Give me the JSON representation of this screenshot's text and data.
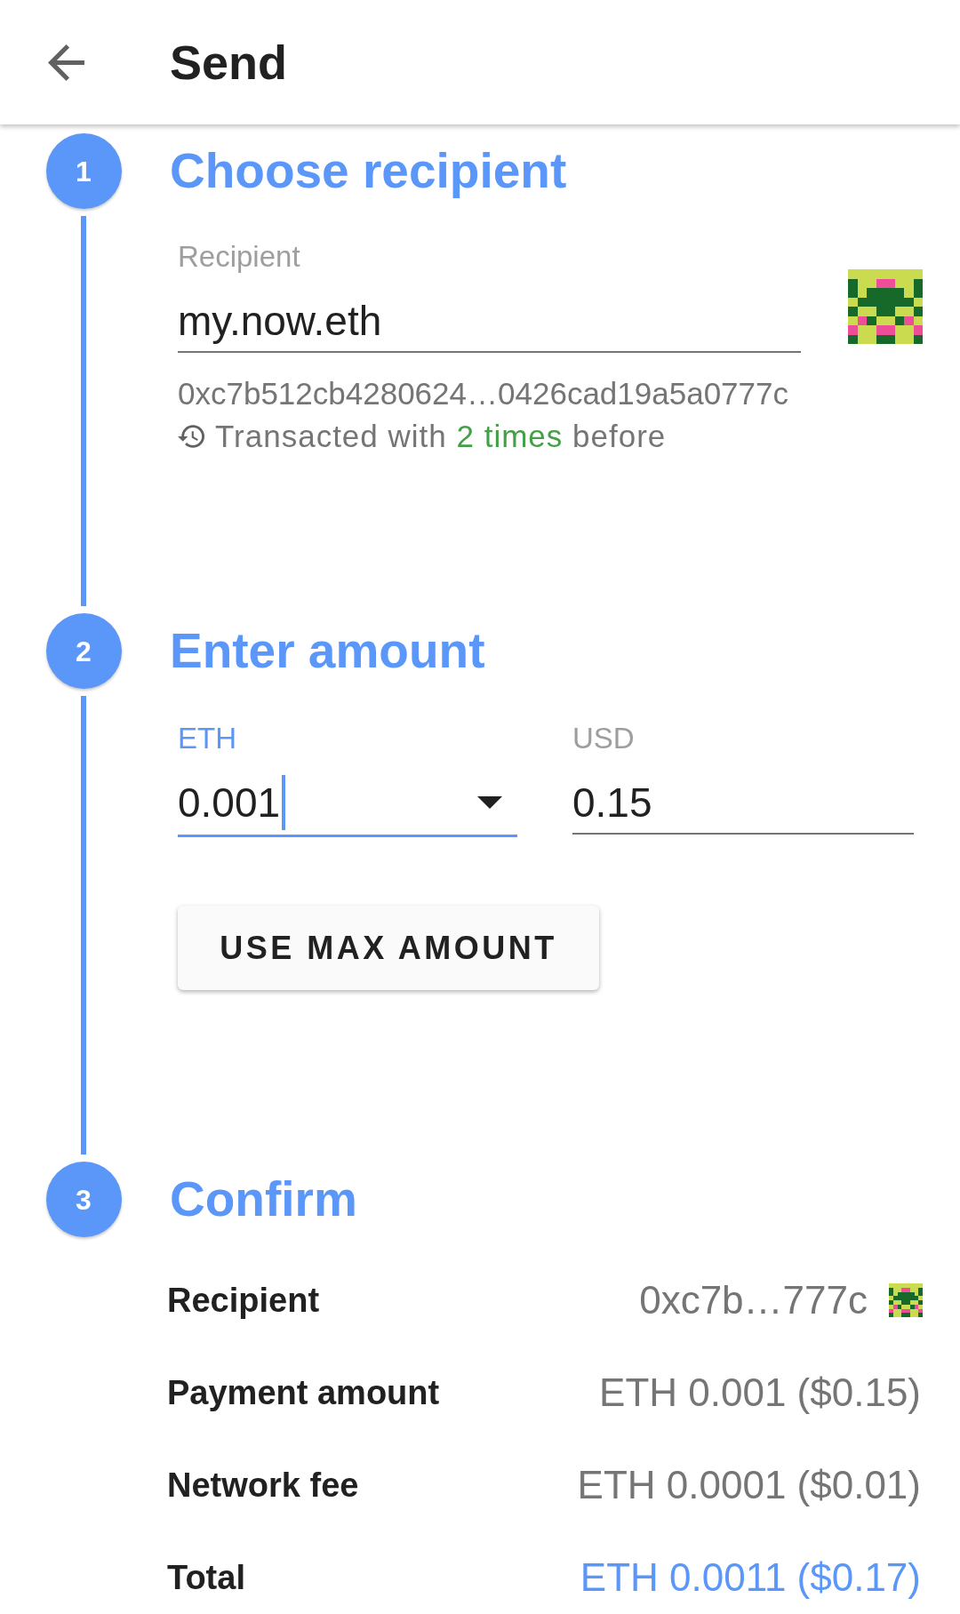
{
  "app_bar": {
    "title": "Send"
  },
  "steps": [
    {
      "number": "1",
      "title": "Choose recipient",
      "kind": "recipient",
      "field": {
        "label": "Recipient",
        "value": "my.now.eth",
        "focused": false,
        "dropdown": false
      },
      "address": "0xc7b512cb4280624…0426cad19a5a0777c",
      "history": {
        "text_before": "Transacted with",
        "highlight": "2 times",
        "text_after": "before"
      }
    },
    {
      "number": "2",
      "title": "Enter amount",
      "kind": "amount",
      "fields": [
        {
          "label": "ETH",
          "value": "0.001",
          "focused": true,
          "dropdown": true
        },
        {
          "label": "USD",
          "value": "0.15",
          "focused": false,
          "dropdown": false
        }
      ],
      "button": "USE MAX AMOUNT"
    },
    {
      "number": "3",
      "title": "Confirm",
      "kind": "summary",
      "rows": [
        {
          "label": "Recipient",
          "value": "0xc7b…777c",
          "kind": "address",
          "highlighted": false
        },
        {
          "label": "Payment amount",
          "value": "ETH 0.001 ($0.15)",
          "kind": "amount",
          "highlighted": false
        },
        {
          "label": "Network fee",
          "value": "ETH 0.0001 ($0.01)",
          "kind": "amount",
          "highlighted": false
        },
        {
          "label": "Total",
          "value": "ETH 0.0011 ($0.17)",
          "kind": "amount",
          "highlighted": true
        }
      ]
    }
  ]
}
